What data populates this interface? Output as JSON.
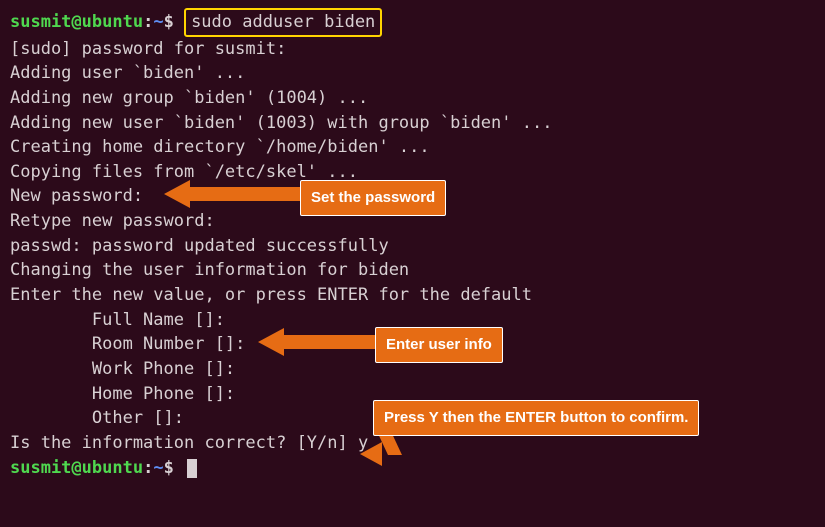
{
  "prompt": {
    "userhost": "susmit@ubuntu",
    "colon": ":",
    "tilde": "~",
    "dollar": "$"
  },
  "command": "sudo adduser biden",
  "output": {
    "l1": "[sudo] password for susmit:",
    "l2": "Adding user `biden' ...",
    "l3": "Adding new group `biden' (1004) ...",
    "l4": "Adding new user `biden' (1003) with group `biden' ...",
    "l5": "Creating home directory `/home/biden' ...",
    "l6": "Copying files from `/etc/skel' ...",
    "l7": "New password:",
    "l8": "Retype new password:",
    "l9": "passwd: password updated successfully",
    "l10": "Changing the user information for biden",
    "l11": "Enter the new value, or press ENTER for the default",
    "l12": "        Full Name []:",
    "l13": "        Room Number []:",
    "l14": "        Work Phone []:",
    "l15": "        Home Phone []:",
    "l16": "        Other []:",
    "l17": "Is the information correct? [Y/n] y"
  },
  "callouts": {
    "c1": "Set the password",
    "c2": "Enter user info",
    "c3": "Press Y then the ENTER button to confirm."
  }
}
